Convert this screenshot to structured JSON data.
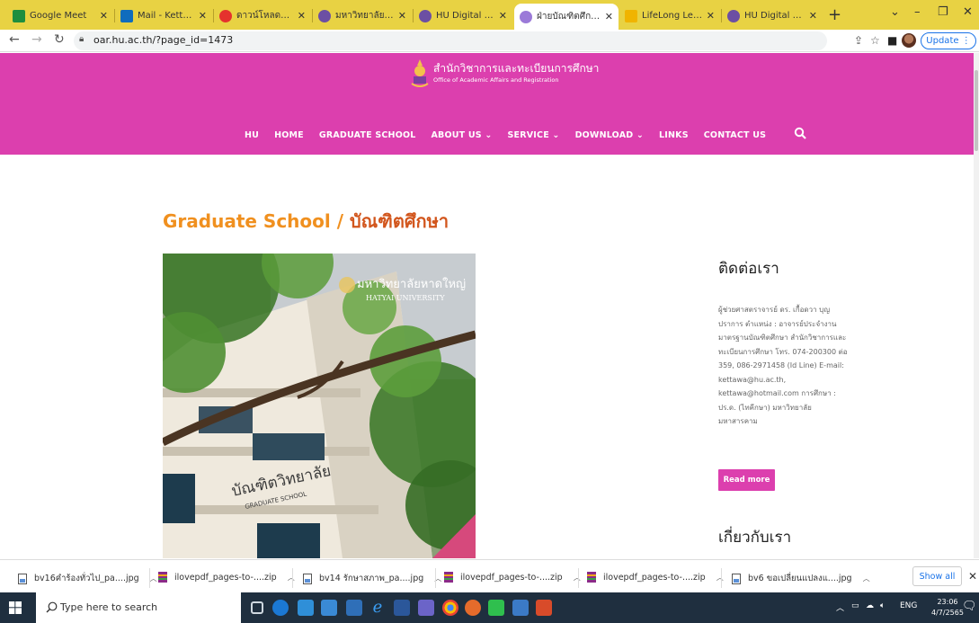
{
  "browser": {
    "tabs": [
      {
        "label": "Google Meet",
        "color": "#1e8e3e"
      },
      {
        "label": "Mail - Kettawa Boo",
        "color": "#0f6cbd"
      },
      {
        "label": "ดาวน์โหลดไฟล์ | iLov",
        "color": "#e5322d"
      },
      {
        "label": "มหาวิทยาลัยหาดใหญ่",
        "color": "#6c4fa3"
      },
      {
        "label": "HU Digital Univers",
        "color": "#6c4fa3"
      },
      {
        "label": "ฝ่ายบัณฑิตศึกษา | สำ",
        "color": "#9b7ad8",
        "active": true
      },
      {
        "label": "LifeLong Learning",
        "color": "#f0b400"
      },
      {
        "label": "HU Digital Univers",
        "color": "#6c4fa3"
      }
    ],
    "url": "oar.hu.ac.th/?page_id=1473",
    "update_label": "Update"
  },
  "site": {
    "logo_th": "สำนักวิชาการและทะเบียนการศึกษา",
    "logo_en": "Office of Academic Affairs and Registration",
    "nav": [
      "HU",
      "HOME",
      "GRADUATE SCHOOL",
      "ABOUT US ⌄",
      "SERVICE ⌄",
      "DOWNLOAD ⌄",
      "LINKS",
      "CONTACT US"
    ],
    "brand_color": "#dc3fae"
  },
  "main": {
    "title_en": "Graduate School / ",
    "title_th": "บัณฑิตศึกษา",
    "photo_sign_th": "มหาวิทยาลัยหาดใหญ่",
    "photo_sign_en": "HATYAI UNIVERSITY",
    "photo_building_th": "บัณฑิตวิทยาลัย",
    "photo_building_en": "GRADUATE SCHOOL"
  },
  "sidebar": {
    "contact_heading": "ติดต่อเรา",
    "contact_text": "ผู้ช่วยศาสตราจารย์ ดร. เกื้อดวา บุญปราการ ตำแหน่ง : อาจารย์ประจำงานมาตรฐานบัณฑิตศึกษา สำนักวิชาการและทะเบียนการศึกษา โทร. 074-200300 ต่อ 359, 086-2971458 (Id Line) E-mail: kettawa@hu.ac.th, kettawa@hotmail.com การศึกษา : ปร.ด. (ไทคีกษา) มหาวิทยาลัยมหาสารคาม",
    "read_more": "Read more",
    "about_heading": "เกี่ยวกับเรา"
  },
  "downloads": {
    "items": [
      {
        "name": "bv16คำร้องทั่วไป_pa....jpg",
        "type": "image"
      },
      {
        "name": "ilovepdf_pages-to-....zip",
        "type": "zip"
      },
      {
        "name": "bv14 รักษาสภาพ_pa....jpg",
        "type": "image"
      },
      {
        "name": "ilovepdf_pages-to-....zip",
        "type": "zip"
      },
      {
        "name": "ilovepdf_pages-to-....zip",
        "type": "zip"
      },
      {
        "name": "bv6 ขอเปลี่ยนแปลงแ....jpg",
        "type": "image"
      }
    ],
    "show_all": "Show all"
  },
  "taskbar": {
    "search_placeholder": "Type here to search",
    "lang": "ENG",
    "time": "23:06",
    "date": "4/7/2565"
  }
}
